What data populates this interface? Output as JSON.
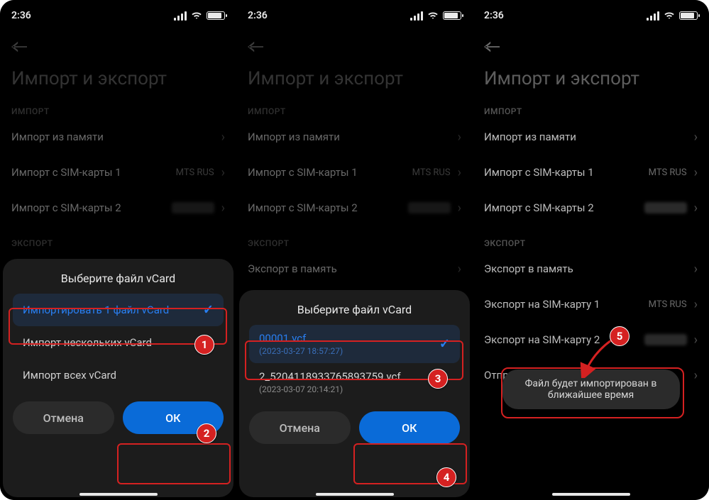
{
  "status": {
    "time": "2:36"
  },
  "page": {
    "title": "Импорт и экспорт",
    "section_import": "ИМПОРТ",
    "section_export": "ЭКСПОРТ",
    "rows_import": [
      {
        "label": "Импорт из памяти",
        "tail": ""
      },
      {
        "label": "Импорт с SIM-карты 1",
        "tail": "MTS RUS"
      },
      {
        "label": "Импорт с SIM-карты 2",
        "tail": ""
      }
    ],
    "rows_export": [
      {
        "label": "Экспорт в память",
        "tail": ""
      },
      {
        "label": "Экспорт на SIM-карту 1",
        "tail": "MTS RUS"
      },
      {
        "label": "Экспорт на SIM-карту 2",
        "tail": ""
      },
      {
        "label": "Отправить контакты",
        "tail": ""
      }
    ]
  },
  "sheet1": {
    "title": "Выберите файл vCard",
    "opt1": "Импортировать 1 файл vCard",
    "opt2": "Импорт нескольких vCard",
    "opt3": "Импорт всех vCard",
    "cancel": "Отмена",
    "ok": "ОК"
  },
  "sheet2": {
    "title": "Выберите файл vCard",
    "file1": {
      "name": "00001.vcf",
      "date": "(2023-03-27 18:57:27)"
    },
    "file2": {
      "name": "2_5204118933765893759.vcf",
      "date": "(2023-03-07 20:14:21)"
    },
    "cancel": "Отмена",
    "ok": "ОК"
  },
  "toast": {
    "text": "Файл будет импортирован в ближайшее время"
  },
  "badges": {
    "1": "1",
    "2": "2",
    "3": "3",
    "4": "4",
    "5": "5"
  }
}
